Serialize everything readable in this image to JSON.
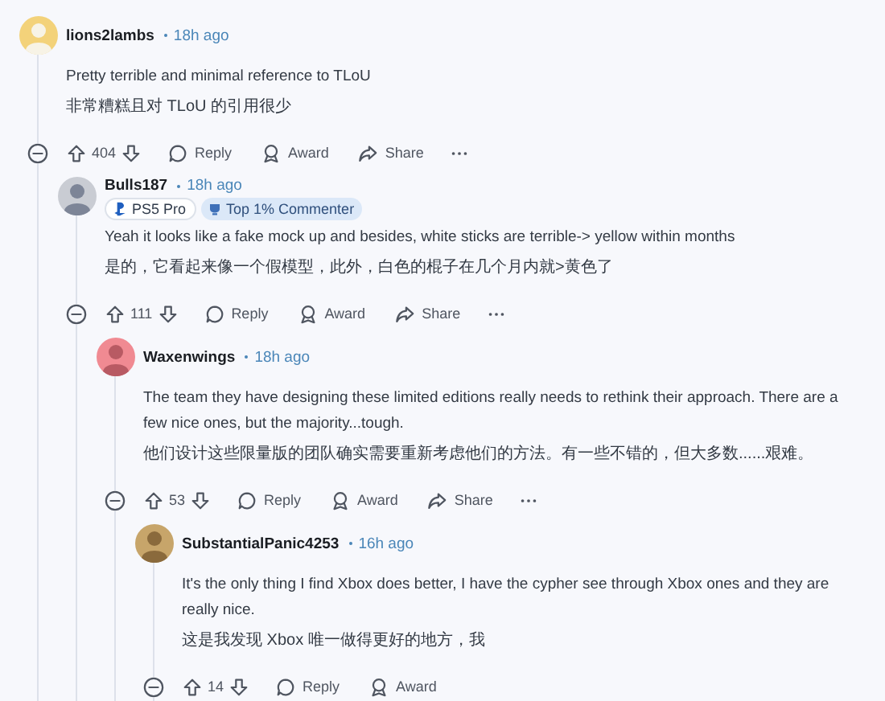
{
  "comments": [
    {
      "author": "lions2lambs",
      "time": "18h ago",
      "body": [
        "Pretty terrible and minimal reference to TLoU",
        "非常糟糕且对 TLoU 的引用很少"
      ],
      "actions": [
        {
          "kind": "score",
          "label": "404"
        },
        {
          "kind": "reply",
          "label": "Reply"
        },
        {
          "kind": "award",
          "label": "Award"
        },
        {
          "kind": "share",
          "label": "Share"
        },
        {
          "kind": "more"
        }
      ],
      "children": [
        {
          "author": "Bulls187",
          "time": "18h ago",
          "badges": [
            {
              "kind": "flair",
              "label": "PS5 Pro"
            },
            {
              "kind": "achievement",
              "label": "Top 1% Commenter"
            }
          ],
          "body": [
            "Yeah it looks like a fake mock up and besides, white sticks are terrible-> yellow within months",
            "是的，它看起来像一个假模型，此外，白色的棍子在几个月内就>黄色了"
          ],
          "actions": [
            {
              "kind": "score",
              "label": "111"
            },
            {
              "kind": "reply",
              "label": "Reply"
            },
            {
              "kind": "award",
              "label": "Award"
            },
            {
              "kind": "share",
              "label": "Share"
            },
            {
              "kind": "more"
            }
          ],
          "children": [
            {
              "author": "Waxenwings",
              "time": "18h ago",
              "body": [
                "The team they have designing these limited editions really needs to rethink their approach. There are a few nice ones, but the majority...tough.",
                "他们设计这些限量版的团队确实需要重新考虑他们的方法。有一些不错的，但大多数......艰难。"
              ],
              "actions": [
                {
                  "kind": "score",
                  "label": "53"
                },
                {
                  "kind": "reply",
                  "label": "Reply"
                },
                {
                  "kind": "award",
                  "label": "Award"
                },
                {
                  "kind": "share",
                  "label": "Share"
                },
                {
                  "kind": "more"
                }
              ],
              "children": [
                {
                  "author": "SubstantialPanic4253",
                  "time": "16h ago",
                  "body": [
                    "It's the only thing I find Xbox does better, I have the cypher see through Xbox ones and they are really nice.",
                    "这是我发现 Xbox 唯一做得更好的地方，我"
                  ],
                  "actions": [
                    {
                      "kind": "score",
                      "label": "14"
                    },
                    {
                      "kind": "reply",
                      "label": "Reply"
                    },
                    {
                      "kind": "award",
                      "label": "Award"
                    }
                  ]
                }
              ]
            }
          ]
        }
      ]
    }
  ]
}
